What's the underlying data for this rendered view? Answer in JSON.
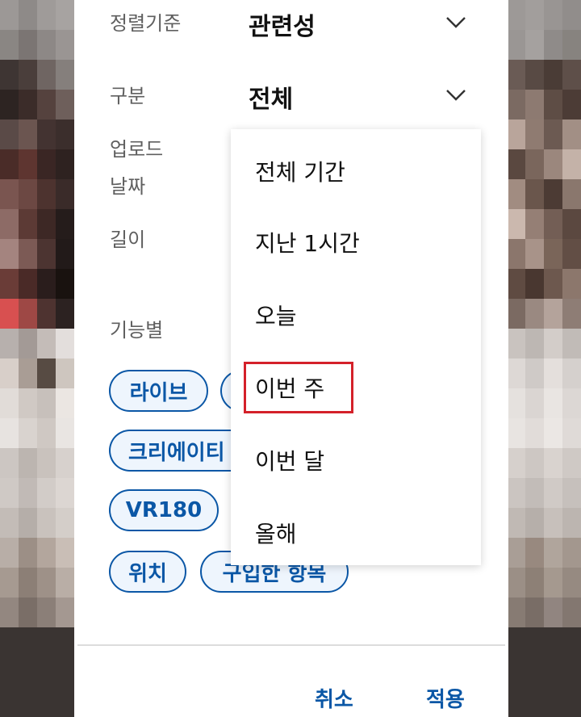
{
  "filter": {
    "sort_label": "정렬기준",
    "sort_value": "관련성",
    "type_label": "구분",
    "type_value": "전체",
    "upload_label_line1": "업로드",
    "upload_label_line2": "날짜",
    "length_label": "길이",
    "features_label": "기능별"
  },
  "chips": [
    "라이브",
    "크리에이티",
    "VR180",
    "위치",
    "구입한 항목"
  ],
  "dropdown": {
    "options": [
      "전체 기간",
      "지난 1시간",
      "오늘",
      "이번 주",
      "이번 달",
      "올해"
    ],
    "highlighted": "이번 주"
  },
  "actions": {
    "cancel_label": "취소",
    "apply_label": "적용"
  },
  "colors": {
    "accent": "#0b57a6",
    "chip_bg": "#eef5fd",
    "highlight_box": "#d4212a"
  }
}
